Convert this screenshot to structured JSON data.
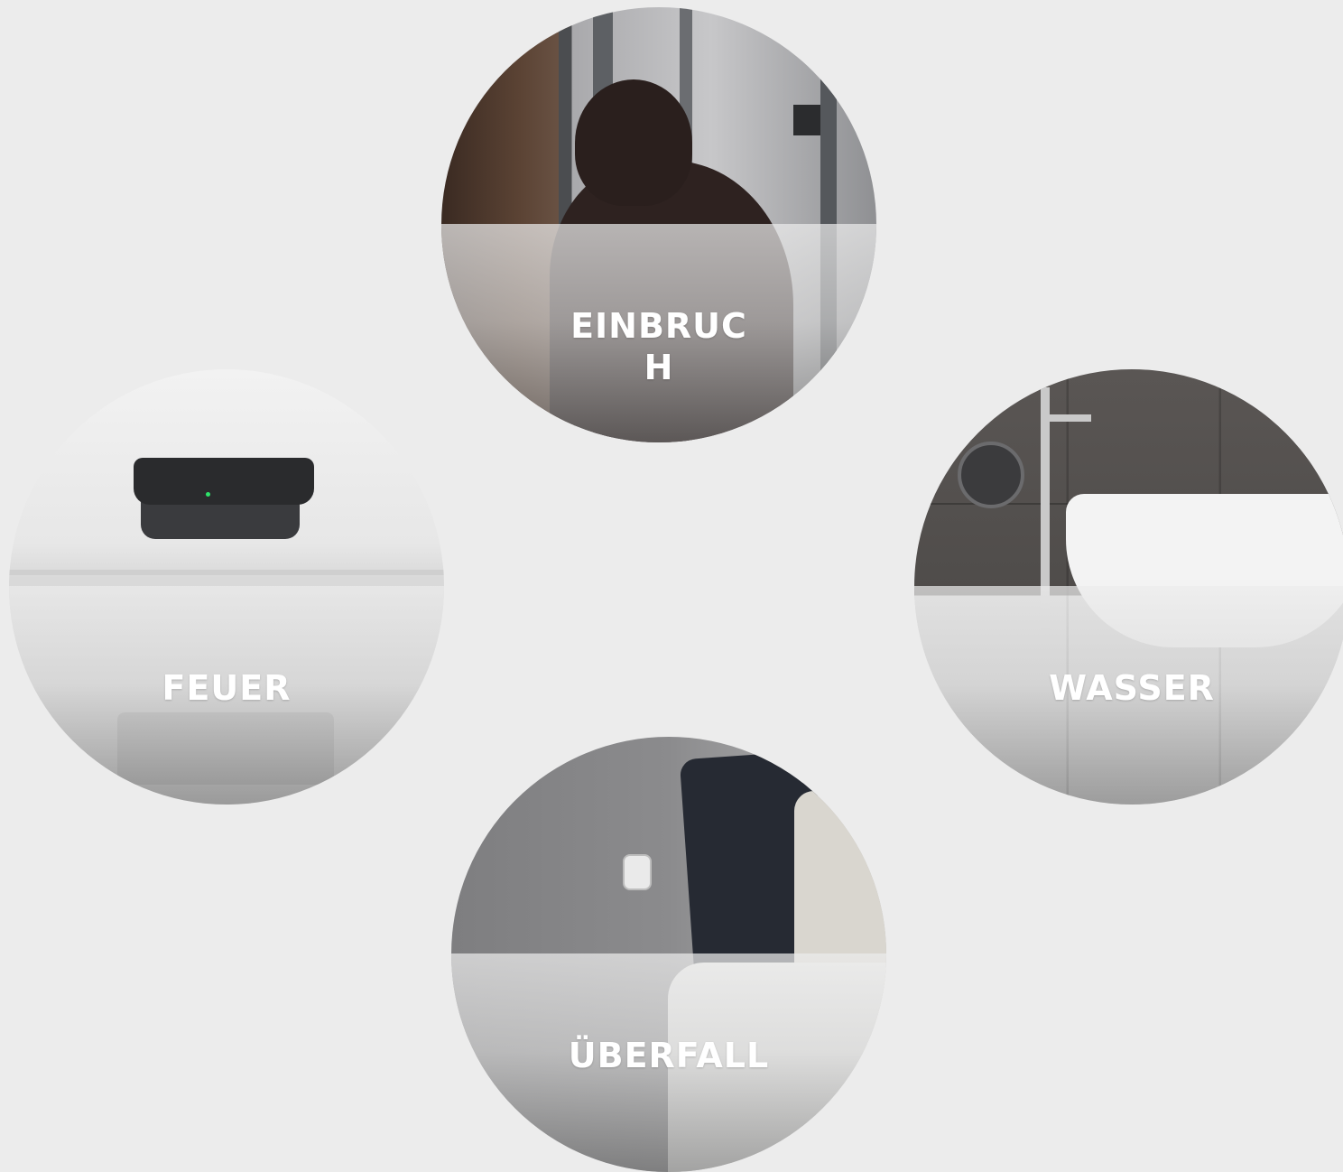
{
  "tiles": {
    "burglary": {
      "label": "EINBRUC\nH"
    },
    "fire": {
      "label": "FEUER"
    },
    "water": {
      "label": "WASSER"
    },
    "panic": {
      "label": "ÜBERFALL"
    }
  }
}
